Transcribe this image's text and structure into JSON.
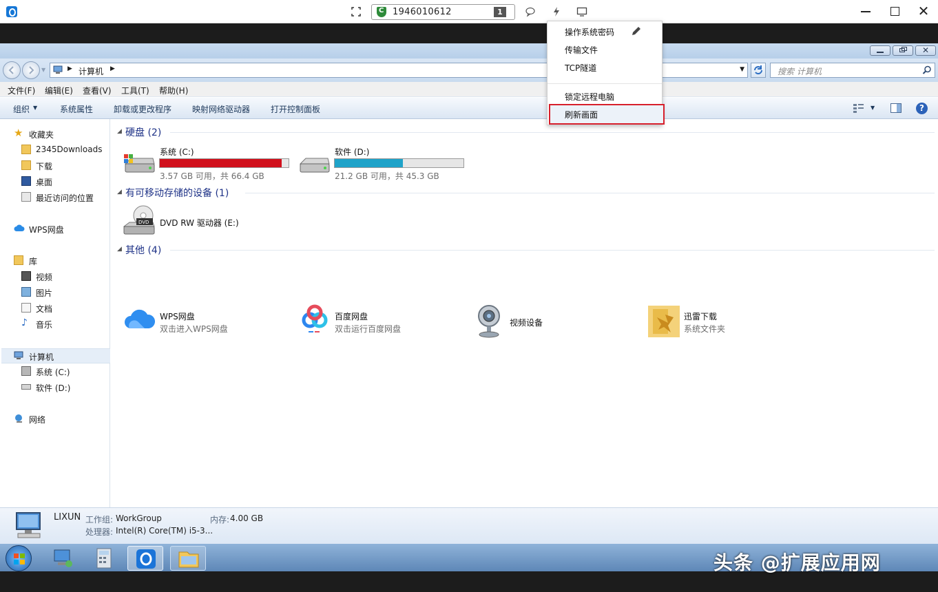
{
  "remote_bar": {
    "remote_id": "1946010612",
    "connection_count": "1"
  },
  "dropdown": {
    "items": [
      "操作系统密码",
      "传输文件",
      "TCP隧道",
      "锁定远程电脑",
      "刷新画面"
    ]
  },
  "explorer": {
    "address": {
      "location": "计算机"
    },
    "search": {
      "placeholder": "搜索 计算机"
    },
    "menu": [
      "文件(F)",
      "编辑(E)",
      "查看(V)",
      "工具(T)",
      "帮助(H)"
    ],
    "commands": [
      "组织",
      "系统属性",
      "卸载或更改程序",
      "映射网络驱动器",
      "打开控制面板"
    ],
    "nav": {
      "favorites": "收藏夹",
      "favorites_items": [
        "2345Downloads",
        "下载",
        "桌面",
        "最近访问的位置"
      ],
      "wps": "WPS网盘",
      "library": "库",
      "library_items": [
        "视频",
        "图片",
        "文档",
        "音乐"
      ],
      "computer": "计算机",
      "computer_items": [
        "系统 (C:)",
        "软件 (D:)"
      ],
      "network": "网络"
    },
    "groups": {
      "hdd": "硬盘 (2)",
      "removable": "有可移动存储的设备 (1)",
      "other": "其他 (4)"
    },
    "drives": [
      {
        "label": "系统 (C:)",
        "sub": "3.57 GB 可用，共 66.4 GB",
        "used_fraction": 0.946,
        "color": "#d1101c"
      },
      {
        "label": "软件 (D:)",
        "sub": "21.2 GB 可用，共 45.3 GB",
        "used_fraction": 0.532,
        "color": "#1fa3c9"
      }
    ],
    "dvd": {
      "label": "DVD RW 驱动器 (E:)"
    },
    "other_items": [
      {
        "title": "WPS网盘",
        "sub": "双击进入WPS网盘"
      },
      {
        "title": "百度网盘",
        "sub": "双击运行百度网盘"
      },
      {
        "title": "视频设备",
        "sub": ""
      },
      {
        "title": "迅雷下载",
        "sub": "系统文件夹"
      }
    ],
    "details": {
      "name": "LIXUN",
      "workgroup_label": "工作组:",
      "workgroup": "WorkGroup",
      "memory_label": "内存:",
      "memory": "4.00 GB",
      "cpu_label": "处理器:",
      "cpu": "Intel(R) Core(TM) i5-3..."
    }
  },
  "watermark": "头条 @扩展应用网"
}
